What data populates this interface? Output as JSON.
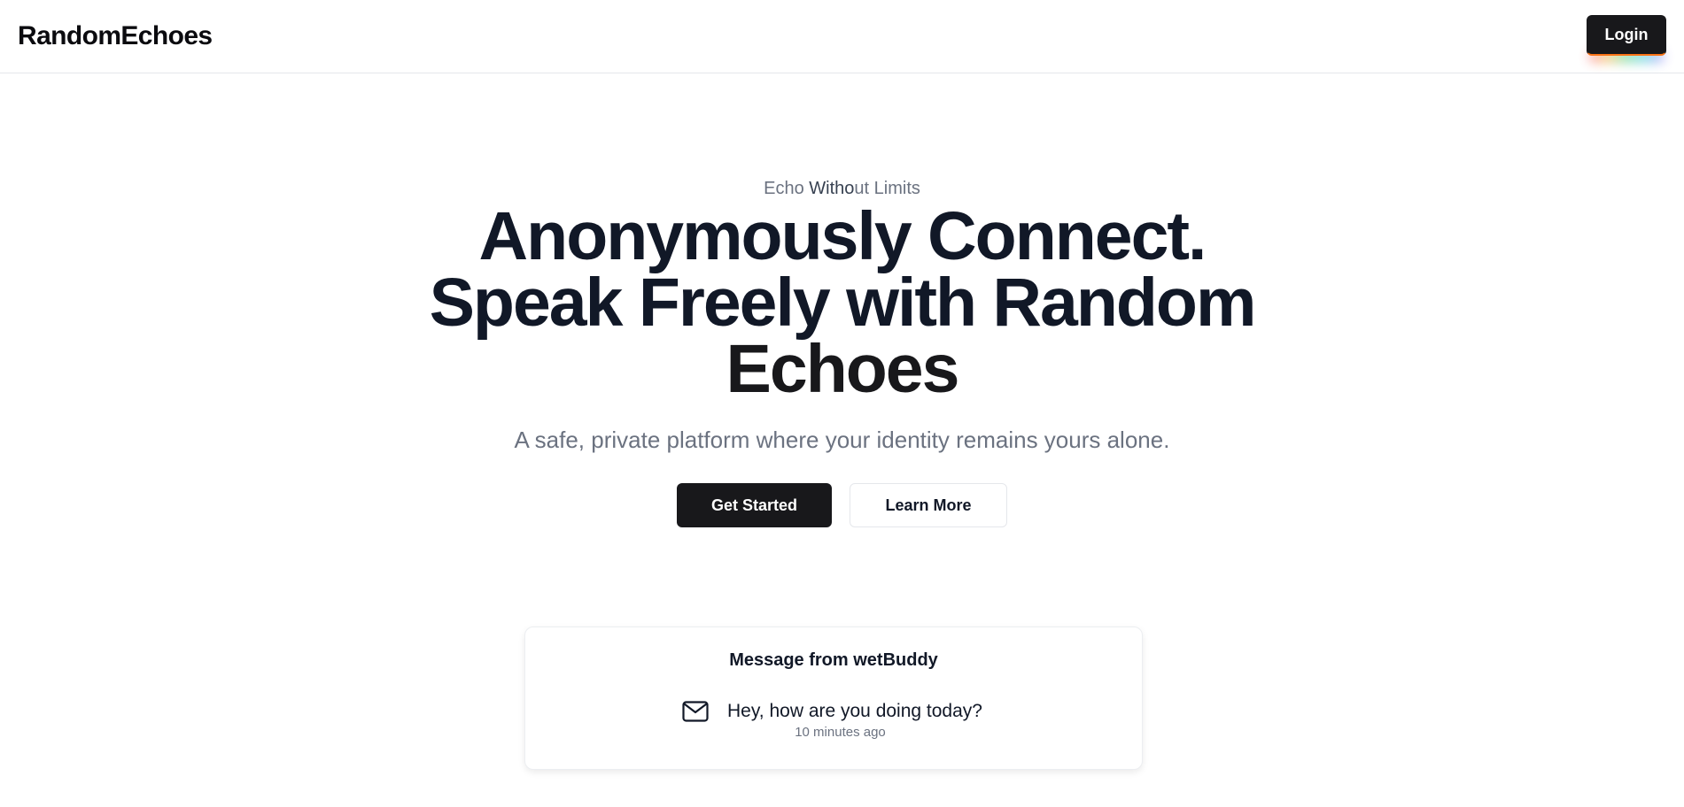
{
  "header": {
    "brand": "RandomEchoes",
    "login_label": "Login"
  },
  "hero": {
    "eyebrow_part1": "Echo ",
    "eyebrow_part2": "Witho",
    "eyebrow_part3": "ut Limits",
    "headline_line1": "Anonymously Connect.",
    "headline_line2": "Speak Freely with Random",
    "headline_line3": "Echoes",
    "subtext": "A safe, private platform where your identity remains yours alone.",
    "primary_cta": "Get Started",
    "secondary_cta": "Learn More"
  },
  "message_card": {
    "title": "Message from wetBuddy",
    "icon": "mail-icon",
    "text": "Hey, how are you doing today?",
    "time": "10 minutes ago"
  }
}
